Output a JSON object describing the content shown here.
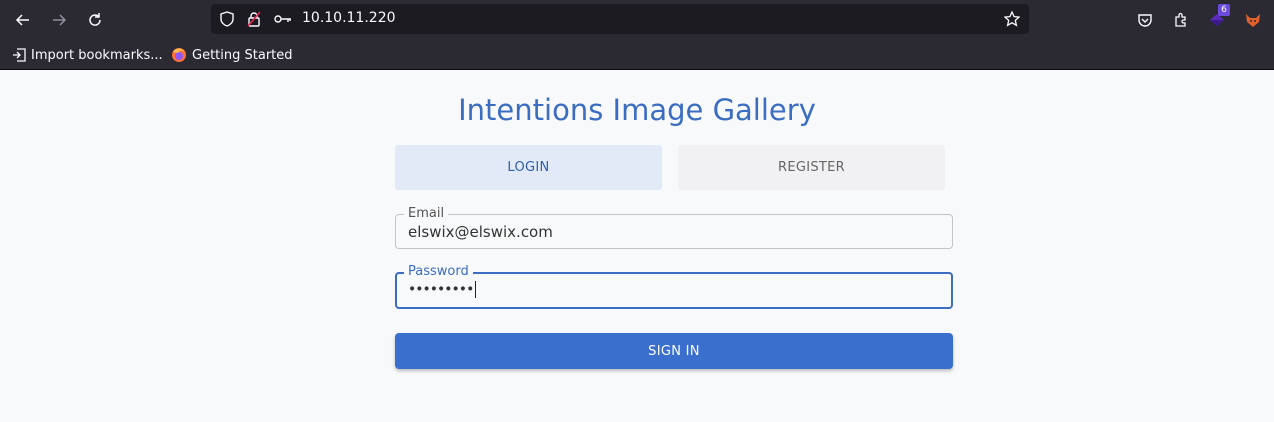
{
  "browser": {
    "url": "10.10.11.220",
    "bookmarks": [
      {
        "label": "Import bookmarks...",
        "icon": "import-icon"
      },
      {
        "label": "Getting Started",
        "icon": "firefox-icon"
      }
    ],
    "extension_badge": "6"
  },
  "page": {
    "title": "Intentions Image Gallery",
    "tabs": {
      "login": "LOGIN",
      "register": "REGISTER"
    },
    "email": {
      "label": "Email",
      "value": "elswix@elswix.com"
    },
    "password": {
      "label": "Password",
      "value": "•••••••••"
    },
    "submit_label": "SIGN IN"
  },
  "colors": {
    "accent": "#3b6dc2",
    "chrome": "#2b2a33"
  }
}
